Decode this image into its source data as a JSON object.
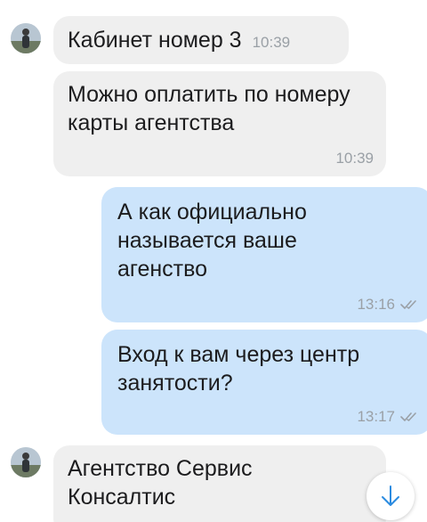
{
  "messages": [
    {
      "direction": "incoming",
      "text": "Кабинет номер 3",
      "time": "10:39"
    },
    {
      "direction": "incoming",
      "text": "Можно оплатить по номеру карты агентства",
      "time": "10:39"
    },
    {
      "direction": "outgoing",
      "text": "А как официально называется ваше агенство",
      "time": "13:16",
      "status": "read"
    },
    {
      "direction": "outgoing",
      "text": "Вход к вам через центр занятости?",
      "time": "13:17",
      "status": "read"
    },
    {
      "direction": "incoming",
      "text": "Агентство Сервис Консалтис",
      "time": ""
    }
  ],
  "icons": {
    "avatar": "avatar-icon",
    "read_status": "double-check-icon",
    "scroll_down": "arrow-down-icon"
  },
  "colors": {
    "incoming_bubble": "#efefef",
    "outgoing_bubble": "#cce4fb",
    "text": "#1c1c1e",
    "time": "#9aa0a6",
    "accent": "#2b8be0"
  }
}
